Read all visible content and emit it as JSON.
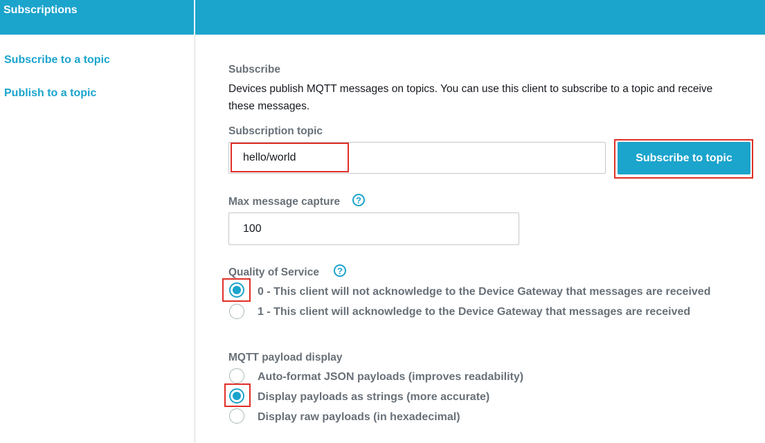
{
  "header": {
    "title": "Subscriptions"
  },
  "sidebar": {
    "items": [
      {
        "label": "Subscribe to a topic"
      },
      {
        "label": "Publish to a topic"
      }
    ]
  },
  "main": {
    "section_title": "Subscribe",
    "description": "Devices publish MQTT messages on topics. You can use this client to subscribe to a topic and receive these messages.",
    "topic_label": "Subscription topic",
    "topic_value": "hello/world",
    "subscribe_button": "Subscribe to topic",
    "max_capture_label": "Max message capture",
    "max_capture_value": "100",
    "qos_label": "Quality of Service",
    "qos_options": [
      {
        "label": "0 - This client will not acknowledge to the Device Gateway that messages are received",
        "selected": true
      },
      {
        "label": "1 - This client will acknowledge to the Device Gateway that messages are received",
        "selected": false
      }
    ],
    "payload_label": "MQTT payload display",
    "payload_options": [
      {
        "label": "Auto-format JSON payloads (improves readability)",
        "selected": false
      },
      {
        "label": "Display payloads as strings (more accurate)",
        "selected": true
      },
      {
        "label": "Display raw payloads (in hexadecimal)",
        "selected": false
      }
    ],
    "help_glyph": "?"
  },
  "colors": {
    "accent": "#1ba4cc",
    "highlight": "#e02f27",
    "label": "#687078"
  }
}
